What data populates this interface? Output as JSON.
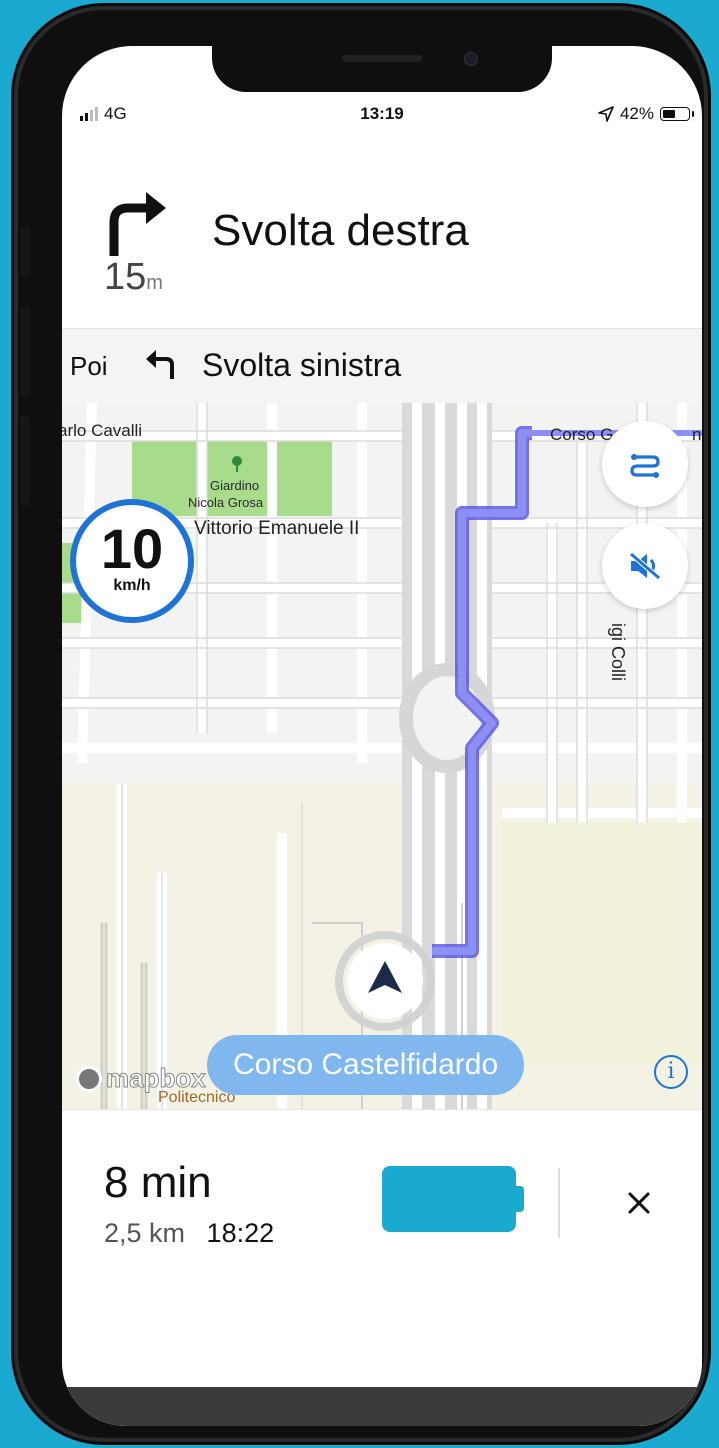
{
  "status_bar": {
    "network": "4G",
    "time": "13:19",
    "battery": "42%"
  },
  "turn": {
    "instruction": "Svolta destra",
    "distance_value": "15",
    "distance_unit": "m",
    "icon": "turn-right-icon"
  },
  "next": {
    "prefix": "Poi",
    "instruction": "Svolta sinistra",
    "icon": "turn-left-icon"
  },
  "map": {
    "labels": {
      "carlo_cavalli": "arlo Cavalli",
      "corso_top": "Corso G",
      "corso_top_end": "no",
      "giardino": "Giardino",
      "nicola_grosa": "Nicola Grosa",
      "vittorio": "Vittorio Emanuele II",
      "colli": "igi Colli",
      "politecnico": "Politecnico"
    },
    "speed_limit": {
      "value": "10",
      "unit": "km/h"
    },
    "current_street": "Corso Castelfidardo",
    "logo": "mapbox",
    "route_color": "#7b7cf0",
    "park_color": "#a8dc8c"
  },
  "trip": {
    "duration": "8 min",
    "distance": "2,5 km",
    "arrival": "18:22",
    "battery_color": "#1aa9cf"
  }
}
